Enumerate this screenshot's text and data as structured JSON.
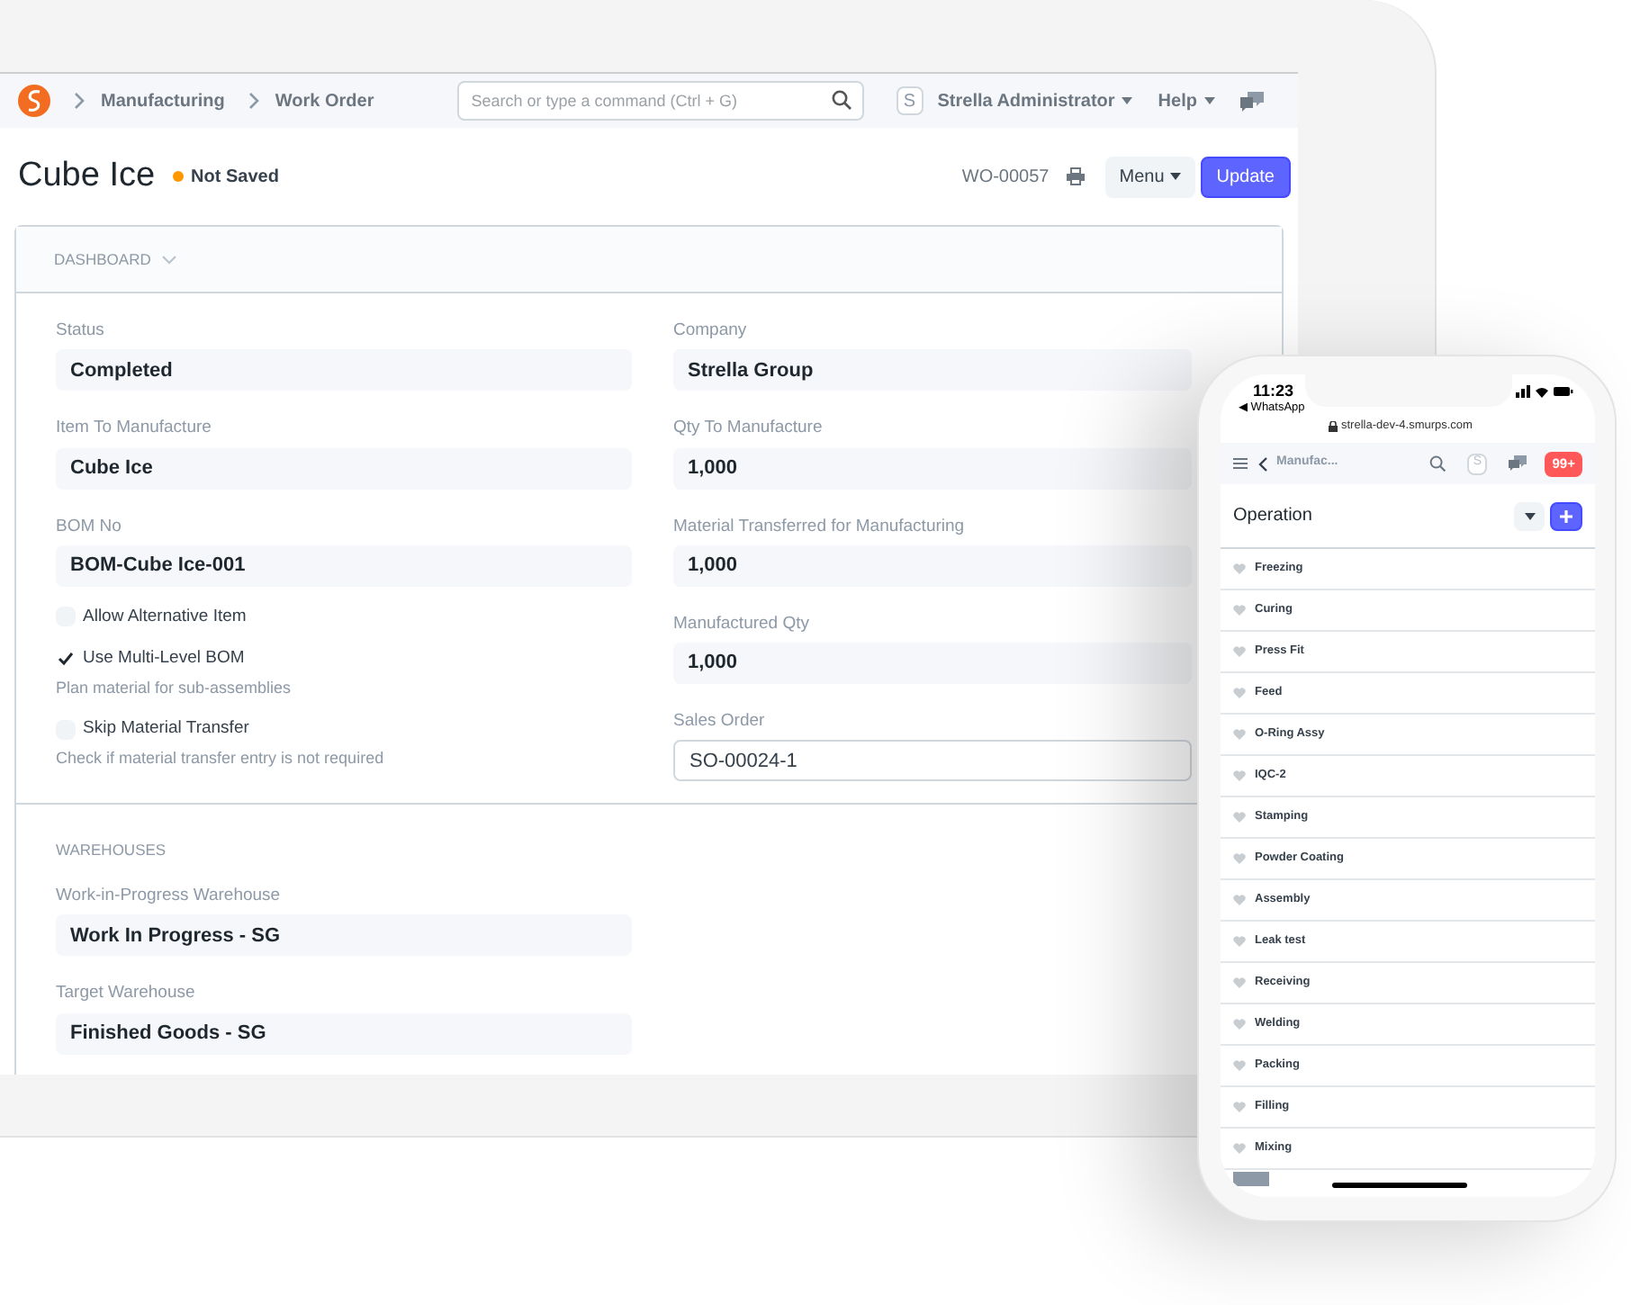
{
  "nav": {
    "breadcrumbs": [
      "Manufacturing",
      "Work Order"
    ],
    "search_placeholder": "Search or type a command (Ctrl + G)",
    "avatar": "S",
    "user": "Strella Administrator",
    "help": "Help"
  },
  "title_bar": {
    "title": "Cube Ice",
    "indicator": "Not Saved",
    "doc_name": "WO-00057",
    "menu": "Menu",
    "primary": "Update"
  },
  "dashboard": {
    "label": "DASHBOARD"
  },
  "fields_left": [
    {
      "label": "Status",
      "value": "Completed"
    },
    {
      "label": "Item To Manufacture",
      "value": "Cube Ice"
    },
    {
      "label": "BOM No",
      "value": "BOM-Cube Ice-001"
    }
  ],
  "checks": [
    {
      "label": "Allow Alternative Item",
      "checked": false
    },
    {
      "label": "Use Multi-Level BOM",
      "checked": true,
      "description": "Plan material for sub-assemblies"
    },
    {
      "label": "Skip Material Transfer",
      "checked": false,
      "description": "Check if material transfer entry is not required"
    }
  ],
  "fields_right": [
    {
      "label": "Company",
      "value": "Strella Group",
      "kind": "readonly"
    },
    {
      "label": "Qty To Manufacture",
      "value": "1,000",
      "kind": "readonly"
    },
    {
      "label": "Material Transferred for Manufacturing",
      "value": "1,000",
      "kind": "readonly"
    },
    {
      "label": "Manufactured Qty",
      "value": "1,000",
      "kind": "readonly"
    },
    {
      "label": "Sales Order",
      "value": "SO-00024-1",
      "kind": "input"
    }
  ],
  "warehouses": {
    "heading": "WAREHOUSES",
    "fields": [
      {
        "label": "Work-in-Progress Warehouse",
        "value": "Work In Progress - SG"
      },
      {
        "label": "Target Warehouse",
        "value": "Finished Goods - SG"
      }
    ]
  },
  "phone": {
    "time": "11:23",
    "back_app": "◀ WhatsApp",
    "url": "strella-dev-4.smurps.com",
    "breadcrumb": "Manufac...",
    "avatar": "S",
    "badge": "99+",
    "heading": "Operation",
    "items": [
      {
        "label": "Freezing"
      },
      {
        "label": "Curing"
      },
      {
        "label": "Press Fit"
      },
      {
        "label": "Feed"
      },
      {
        "label": "O-Ring Assy"
      },
      {
        "label": "IQC-2"
      },
      {
        "label": "Stamping"
      },
      {
        "label": "Powder Coating"
      },
      {
        "label": "Assembly"
      },
      {
        "label": "Leak test"
      },
      {
        "label": "Receiving"
      },
      {
        "label": "Welding"
      },
      {
        "label": "Packing"
      },
      {
        "label": "Filling"
      },
      {
        "label": "Mixing"
      }
    ]
  }
}
